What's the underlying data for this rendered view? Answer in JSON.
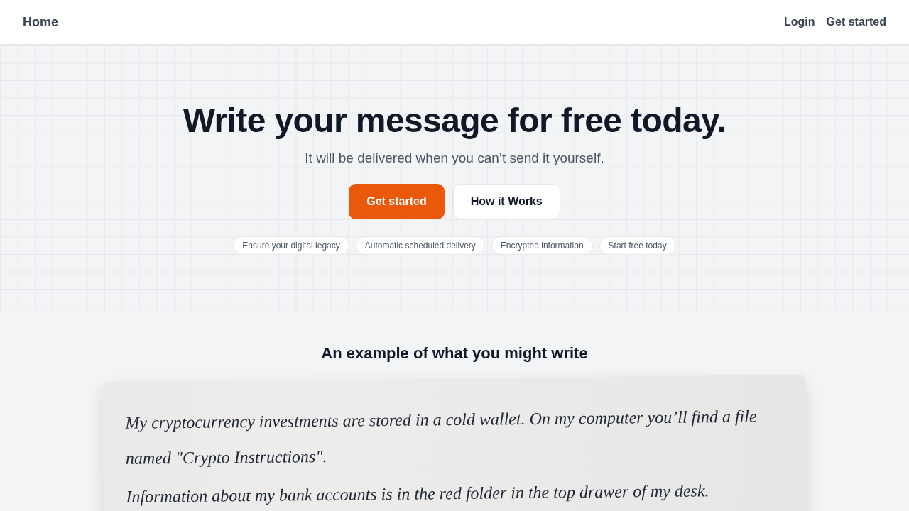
{
  "nav": {
    "brand": "Home",
    "links": [
      "Login",
      "Get started"
    ]
  },
  "hero": {
    "title": "Write your message for free today.",
    "subtitle": "It will be delivered when you can’t send it yourself.",
    "buttons": [
      {
        "label": "Get started",
        "kind": "primary"
      },
      {
        "label": "How it Works",
        "kind": "secondary"
      }
    ],
    "features": [
      "Ensure your digital legacy",
      "Automatic scheduled delivery",
      "Encrypted information",
      "Start free today"
    ]
  },
  "example": {
    "heading": "An example of what you might write",
    "paragraphs": [
      "My cryptocurrency investments are stored in a cold wallet. On my computer you’ll find a file named \"Crypto Instructions\".",
      "Information about my bank accounts is in the red folder in the top drawer of my desk."
    ]
  }
}
